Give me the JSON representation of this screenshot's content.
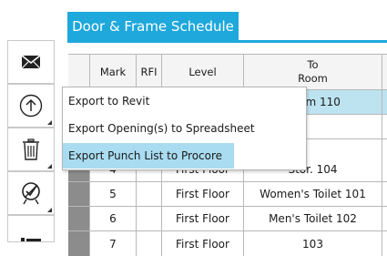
{
  "title": "Door & Frame Schedule",
  "toolbar": {
    "buttons": [
      {
        "icon": "envelope-icon"
      },
      {
        "icon": "upload-arrow-icon"
      },
      {
        "icon": "trash-icon"
      },
      {
        "icon": "no-check-icon"
      },
      {
        "icon": "list-icon"
      }
    ]
  },
  "table": {
    "headers": {
      "mark": "Mark",
      "rfi": "RFI",
      "level": "Level",
      "to_room_line1": "To",
      "to_room_line2": "Room"
    },
    "rows": [
      {
        "mark": "",
        "rfi": "",
        "level": "",
        "room": "Room 110",
        "selected": true
      },
      {
        "mark": "",
        "rfi": "",
        "level": "",
        "room": ""
      },
      {
        "mark": "",
        "rfi": "",
        "level": "",
        "room": ""
      },
      {
        "mark": "4",
        "rfi": "",
        "level": "First Floor",
        "room": "Stor. 104"
      },
      {
        "mark": "5",
        "rfi": "",
        "level": "First Floor",
        "room": "Women's Toilet 101"
      },
      {
        "mark": "6",
        "rfi": "",
        "level": "First Floor",
        "room": "Men's Toilet 102"
      },
      {
        "mark": "7",
        "rfi": "",
        "level": "First Floor",
        "room": "103"
      }
    ]
  },
  "context_menu": {
    "items": [
      {
        "label": "Export to Revit"
      },
      {
        "label": "Export Opening(s) to Spreadsheet"
      },
      {
        "label": "Export Punch List to Procore",
        "hovered": true
      }
    ]
  },
  "colors": {
    "accent": "#1ea8dc",
    "selected_row": "#bde3f1",
    "menu_hover": "#a9dcf1"
  }
}
